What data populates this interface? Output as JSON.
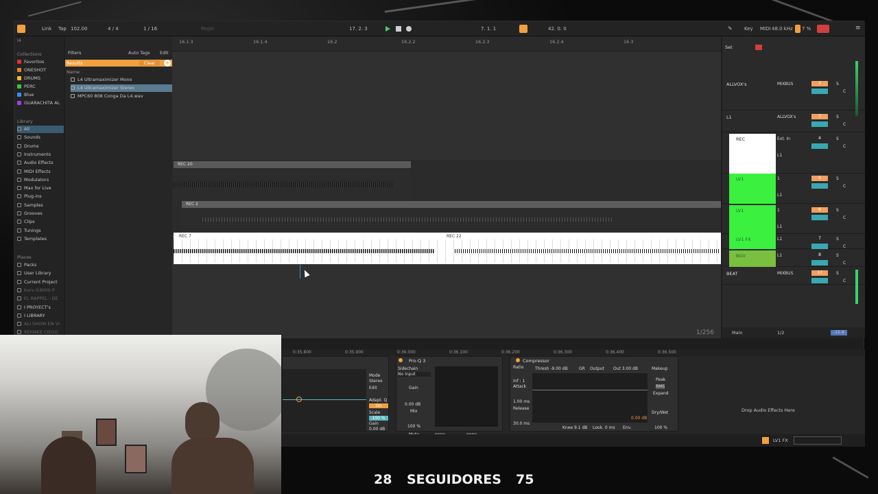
{
  "transport": {
    "link": "Link",
    "tap": "Tap",
    "tempo": "102.00",
    "meter": "4 / 4",
    "quantize": "1 / 16",
    "position": "17.  2.  3",
    "loop_start": "7.  1.  1",
    "loop_len": "42.  0.  0",
    "key": "Key",
    "midi": "MIDI",
    "sample_rate": "48.0 kHz",
    "cpu": "7 %",
    "scale": "Major"
  },
  "sidebar": {
    "collections_header": "Collections",
    "collections": [
      {
        "label": "Favoritos",
        "color": "#e03030"
      },
      {
        "label": "ONESHOT",
        "color": "#f08020"
      },
      {
        "label": "DRUMS",
        "color": "#f0c020"
      },
      {
        "label": "PERC",
        "color": "#40c040"
      },
      {
        "label": "Blue",
        "color": "#3090f0"
      },
      {
        "label": "GUARACHITA AL",
        "color": "#a040e0"
      }
    ],
    "library_header": "Library",
    "library": [
      "All",
      "Sounds",
      "Drums",
      "Instruments",
      "Audio Effects",
      "MIDI Effects",
      "Modulators",
      "Max for Live",
      "Plug-ins",
      "Samples",
      "Grooves",
      "Clips",
      "Tunings",
      "Templates"
    ],
    "places_header": "Places",
    "places": [
      "Packs",
      "User Library",
      "Current Project",
      "kurv-i19000 P",
      "EL RAPPEL - DE",
      "I PROYECT's",
      "I LIBRARY",
      "ALI SHOW EN VI",
      "REMAKE CIEGO"
    ]
  },
  "browser": {
    "search": "l4",
    "filters": "Filters",
    "auto_tags": "Auto Tags",
    "edit": "Edit",
    "results": "Results",
    "clear": "Clear",
    "name_header": "Name",
    "items": [
      "L4 Ultramaximizer Mono",
      "L4 Ultramaximizer Stereo",
      "MPC60 808 Conga Da L4.wav"
    ]
  },
  "ruler": [
    "16.1.3",
    "16.1.4",
    "16.2",
    "16.2.2",
    "16.2.3",
    "16.2.4",
    "16.3"
  ],
  "ruler_bottom": [
    "0:35.800",
    "0:35.900",
    "0:36.000",
    "0:36.100",
    "0:36.200",
    "0:36.300",
    "0:36.400",
    "0:36.500"
  ],
  "clips": {
    "rec20": "REC 20",
    "rec21": "REC 2",
    "rec7": "REC 7",
    "rec22": "REC 22"
  },
  "tracks": [
    {
      "name": "ALLVOX's",
      "route": "MIXBUS",
      "num": "2",
      "numcolor": "#f0a060"
    },
    {
      "name": "L1",
      "route": "ALLVOX's",
      "num": "3",
      "numcolor": "#f0a060"
    },
    {
      "name": "REC",
      "route": "Ext. In",
      "num": "4",
      "numcolor": "#2a2a2a",
      "sub": "L1"
    },
    {
      "name": "LV1",
      "route": "1",
      "num": "5",
      "numcolor": "#f0a060",
      "sub": "L1"
    },
    {
      "name": "LV1",
      "route": "1",
      "num": "6",
      "numcolor": "#f0a060",
      "sub": "L1"
    },
    {
      "name": "LV1 FX",
      "route": "L1",
      "num": "7",
      "numcolor": "#2a2a2a"
    },
    {
      "name": "BGV",
      "route": "L1",
      "num": "8",
      "numcolor": "#2a2a2a"
    },
    {
      "name": "BEAT",
      "route": "MIXBUS",
      "num": "17",
      "numcolor": "#f0a060"
    }
  ],
  "mixer_labels": {
    "in": "In",
    "auto": "Auto",
    "off": "Off",
    "s": "S",
    "c": "C",
    "set": "Set"
  },
  "main_track": {
    "name": "Main",
    "route": "1/2",
    "zoom": "1/256",
    "vol": "-15.8"
  },
  "devices": {
    "eq": {
      "mode_label": "Mode",
      "mode": "Stereo",
      "edit": "Edit",
      "adapt": "Adapt. Q",
      "on": "On",
      "scale": "Scale",
      "scale_val": "100 %",
      "gain": "Gain",
      "gain_val": "0.00 dB",
      "bands": [
        "5",
        "6",
        "7",
        "8"
      ]
    },
    "proq": {
      "title": "Pro-Q 3",
      "sidechain": "Sidechain",
      "no_input": "No Input",
      "gain": "Gain",
      "gain_val": "0.00 dB",
      "mix": "Mix",
      "mix_val": "100 %",
      "mute": "Mute",
      "none1": "none",
      "none2": "none"
    },
    "comp": {
      "title": "Compressor",
      "thresh": "Thresh -9.00 dB",
      "gr": "GR",
      "output": "Output",
      "out_val": "Out 3.00 dB",
      "makeup": "Makeup",
      "ratio": "Ratio",
      "ratio_val": "inf : 1",
      "attack": "Attack",
      "attack_val": "1.00 ms",
      "release": "Release",
      "release_val": "30.0 ms",
      "peak": "Peak",
      "rms": "RMS",
      "expand": "Expand",
      "drywet": "Dry/Wet",
      "drywet_val": "100 %",
      "gain_val": "0.00 dB",
      "knee": "Knee 9.1 dB",
      "look": "Look. 0 ms",
      "env": "Env."
    },
    "drop": "Drop Audio Effects Here"
  },
  "status": {
    "track_name": "LV1 FX"
  },
  "overlay": {
    "left_num": "28",
    "label": "SEGUIDORES",
    "right_num": "75"
  }
}
